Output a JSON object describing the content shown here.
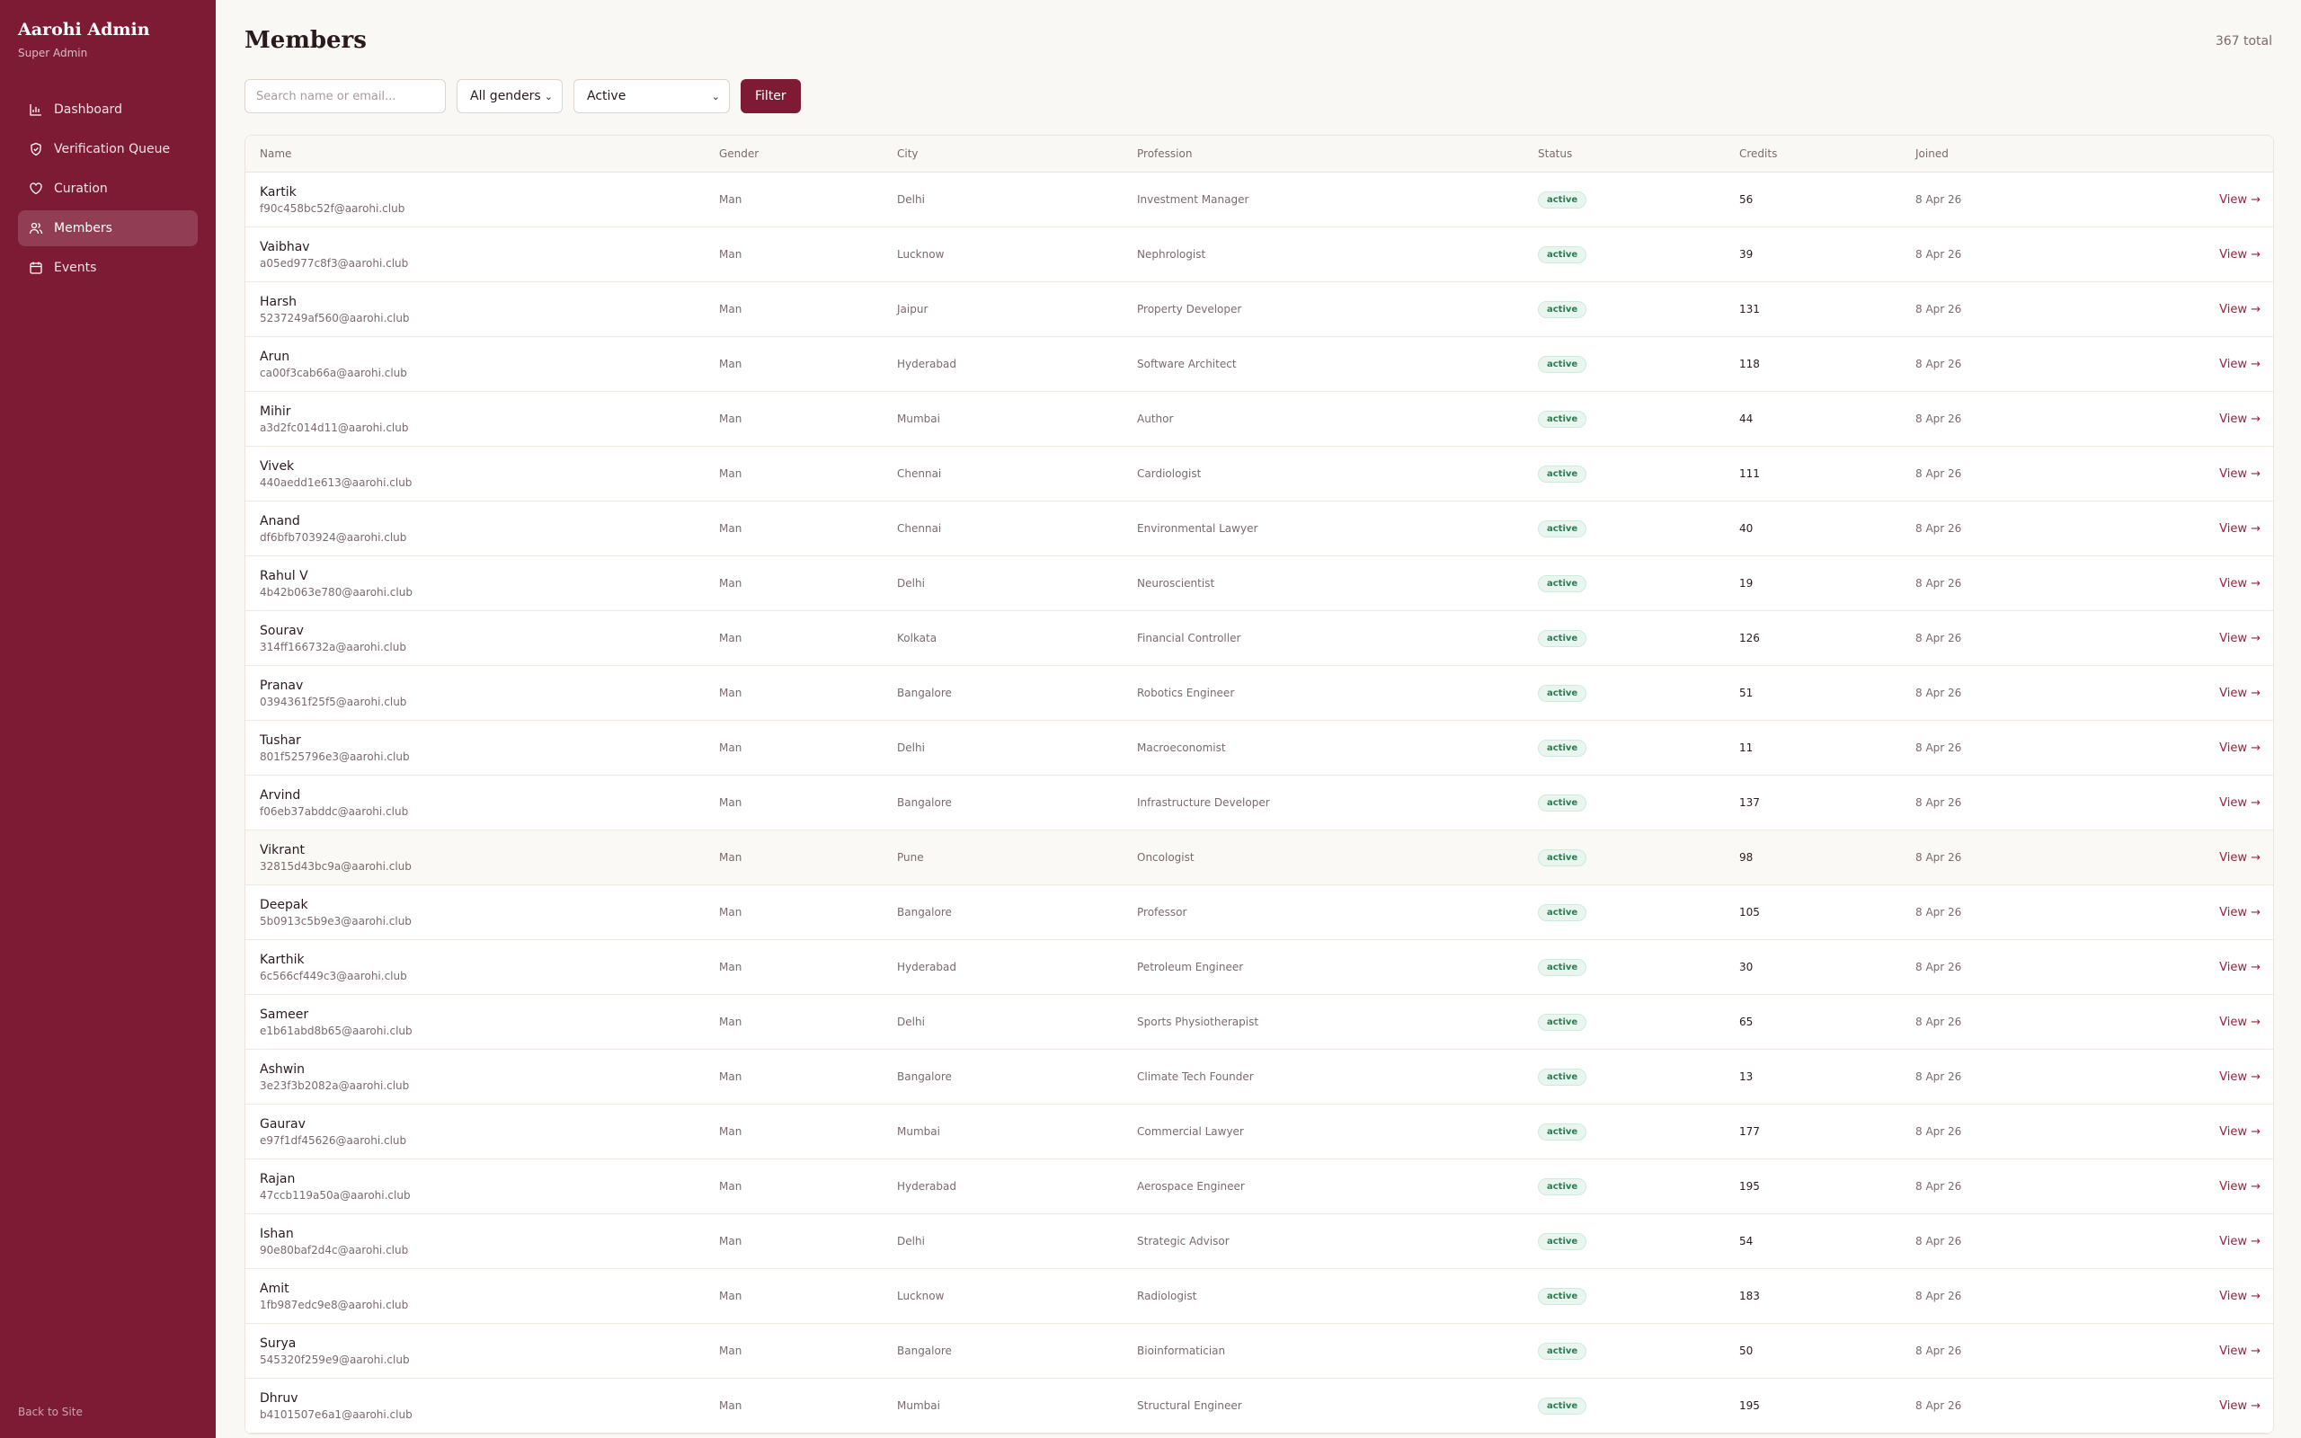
{
  "sidebar": {
    "title": "Aarohi Admin",
    "subtitle": "Super Admin",
    "nav": [
      {
        "label": "Dashboard",
        "icon": "bar-chart-icon",
        "active": false
      },
      {
        "label": "Verification Queue",
        "icon": "shield-check-icon",
        "active": false
      },
      {
        "label": "Curation",
        "icon": "heart-icon",
        "active": false
      },
      {
        "label": "Members",
        "icon": "users-icon",
        "active": true
      },
      {
        "label": "Events",
        "icon": "calendar-icon",
        "active": false
      }
    ],
    "back_label": "Back to Site"
  },
  "page": {
    "title": "Members",
    "total": "367 total"
  },
  "filters": {
    "search_placeholder": "Search name or email...",
    "gender_value": "All genders",
    "status_value": "Active",
    "button_label": "Filter"
  },
  "table": {
    "columns": [
      "Name",
      "Gender",
      "City",
      "Profession",
      "Status",
      "Credits",
      "Joined"
    ],
    "action_label": "View →",
    "rows": [
      {
        "name": "Kartik",
        "email": "f90c458bc52f@aarohi.club",
        "gender": "Man",
        "city": "Delhi",
        "profession": "Investment Manager",
        "status": "active",
        "credits": "56",
        "joined": "8 Apr 26"
      },
      {
        "name": "Vaibhav",
        "email": "a05ed977c8f3@aarohi.club",
        "gender": "Man",
        "city": "Lucknow",
        "profession": "Nephrologist",
        "status": "active",
        "credits": "39",
        "joined": "8 Apr 26"
      },
      {
        "name": "Harsh",
        "email": "5237249af560@aarohi.club",
        "gender": "Man",
        "city": "Jaipur",
        "profession": "Property Developer",
        "status": "active",
        "credits": "131",
        "joined": "8 Apr 26"
      },
      {
        "name": "Arun",
        "email": "ca00f3cab66a@aarohi.club",
        "gender": "Man",
        "city": "Hyderabad",
        "profession": "Software Architect",
        "status": "active",
        "credits": "118",
        "joined": "8 Apr 26"
      },
      {
        "name": "Mihir",
        "email": "a3d2fc014d11@aarohi.club",
        "gender": "Man",
        "city": "Mumbai",
        "profession": "Author",
        "status": "active",
        "credits": "44",
        "joined": "8 Apr 26"
      },
      {
        "name": "Vivek",
        "email": "440aedd1e613@aarohi.club",
        "gender": "Man",
        "city": "Chennai",
        "profession": "Cardiologist",
        "status": "active",
        "credits": "111",
        "joined": "8 Apr 26"
      },
      {
        "name": "Anand",
        "email": "df6bfb703924@aarohi.club",
        "gender": "Man",
        "city": "Chennai",
        "profession": "Environmental Lawyer",
        "status": "active",
        "credits": "40",
        "joined": "8 Apr 26"
      },
      {
        "name": "Rahul V",
        "email": "4b42b063e780@aarohi.club",
        "gender": "Man",
        "city": "Delhi",
        "profession": "Neuroscientist",
        "status": "active",
        "credits": "19",
        "joined": "8 Apr 26"
      },
      {
        "name": "Sourav",
        "email": "314ff166732a@aarohi.club",
        "gender": "Man",
        "city": "Kolkata",
        "profession": "Financial Controller",
        "status": "active",
        "credits": "126",
        "joined": "8 Apr 26"
      },
      {
        "name": "Pranav",
        "email": "0394361f25f5@aarohi.club",
        "gender": "Man",
        "city": "Bangalore",
        "profession": "Robotics Engineer",
        "status": "active",
        "credits": "51",
        "joined": "8 Apr 26"
      },
      {
        "name": "Tushar",
        "email": "801f525796e3@aarohi.club",
        "gender": "Man",
        "city": "Delhi",
        "profession": "Macroeconomist",
        "status": "active",
        "credits": "11",
        "joined": "8 Apr 26"
      },
      {
        "name": "Arvind",
        "email": "f06eb37abddc@aarohi.club",
        "gender": "Man",
        "city": "Bangalore",
        "profession": "Infrastructure Developer",
        "status": "active",
        "credits": "137",
        "joined": "8 Apr 26"
      },
      {
        "name": "Vikrant",
        "email": "32815d43bc9a@aarohi.club",
        "gender": "Man",
        "city": "Pune",
        "profession": "Oncologist",
        "status": "active",
        "credits": "98",
        "joined": "8 Apr 26"
      },
      {
        "name": "Deepak",
        "email": "5b0913c5b9e3@aarohi.club",
        "gender": "Man",
        "city": "Bangalore",
        "profession": "Professor",
        "status": "active",
        "credits": "105",
        "joined": "8 Apr 26"
      },
      {
        "name": "Karthik",
        "email": "6c566cf449c3@aarohi.club",
        "gender": "Man",
        "city": "Hyderabad",
        "profession": "Petroleum Engineer",
        "status": "active",
        "credits": "30",
        "joined": "8 Apr 26"
      },
      {
        "name": "Sameer",
        "email": "e1b61abd8b65@aarohi.club",
        "gender": "Man",
        "city": "Delhi",
        "profession": "Sports Physiotherapist",
        "status": "active",
        "credits": "65",
        "joined": "8 Apr 26"
      },
      {
        "name": "Ashwin",
        "email": "3e23f3b2082a@aarohi.club",
        "gender": "Man",
        "city": "Bangalore",
        "profession": "Climate Tech Founder",
        "status": "active",
        "credits": "13",
        "joined": "8 Apr 26"
      },
      {
        "name": "Gaurav",
        "email": "e97f1df45626@aarohi.club",
        "gender": "Man",
        "city": "Mumbai",
        "profession": "Commercial Lawyer",
        "status": "active",
        "credits": "177",
        "joined": "8 Apr 26"
      },
      {
        "name": "Rajan",
        "email": "47ccb119a50a@aarohi.club",
        "gender": "Man",
        "city": "Hyderabad",
        "profession": "Aerospace Engineer",
        "status": "active",
        "credits": "195",
        "joined": "8 Apr 26"
      },
      {
        "name": "Ishan",
        "email": "90e80baf2d4c@aarohi.club",
        "gender": "Man",
        "city": "Delhi",
        "profession": "Strategic Advisor",
        "status": "active",
        "credits": "54",
        "joined": "8 Apr 26"
      },
      {
        "name": "Amit",
        "email": "1fb987edc9e8@aarohi.club",
        "gender": "Man",
        "city": "Lucknow",
        "profession": "Radiologist",
        "status": "active",
        "credits": "183",
        "joined": "8 Apr 26"
      },
      {
        "name": "Surya",
        "email": "545320f259e9@aarohi.club",
        "gender": "Man",
        "city": "Bangalore",
        "profession": "Bioinformatician",
        "status": "active",
        "credits": "50",
        "joined": "8 Apr 26"
      },
      {
        "name": "Dhruv",
        "email": "b4101507e6a1@aarohi.club",
        "gender": "Man",
        "city": "Mumbai",
        "profession": "Structural Engineer",
        "status": "active",
        "credits": "195",
        "joined": "8 Apr 26"
      }
    ]
  },
  "colors": {
    "sidebar_bg": "#7d1a34",
    "accent": "#7d1a34",
    "page_bg": "#faf8f4",
    "badge_text": "#2f7a52",
    "badge_bg": "#e8f6ef"
  }
}
